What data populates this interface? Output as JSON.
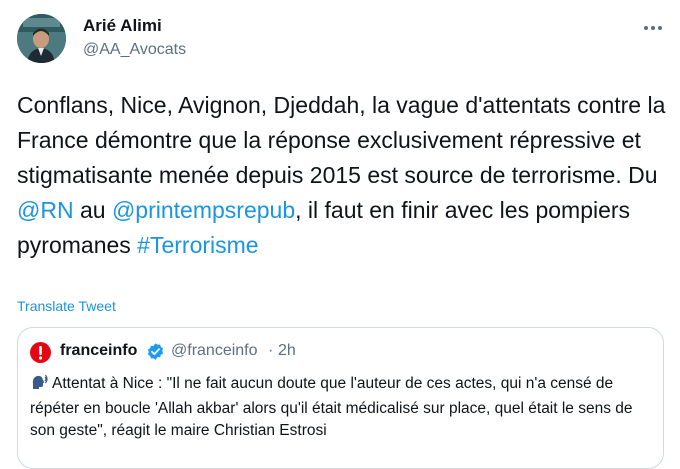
{
  "author": {
    "name": "Arié Alimi",
    "handle": "@AA_Avocats",
    "avatar_icon": "profile-photo"
  },
  "tweet": {
    "segments": [
      {
        "text": "Conflans, Nice, Avignon, Djeddah, la vague d'attentats contre la France démontre que la réponse exclusivement répressive et stigmatisante menée depuis 2015 est source de terrorisme. Du ",
        "link": false
      },
      {
        "text": "@RN",
        "link": true
      },
      {
        "text": " au ",
        "link": false
      },
      {
        "text": "@printempsrepub",
        "link": true
      },
      {
        "text": ", il faut en finir avec les pompiers pyromanes ",
        "link": false
      },
      {
        "text": "#Terrorisme",
        "link": true
      }
    ],
    "translate_label": "Translate Tweet"
  },
  "quote": {
    "name": "franceinfo",
    "verified_icon": "verified-badge-icon",
    "handle": "@franceinfo",
    "separator": "·",
    "time": "2h",
    "emoji_icon": "speaking-head-icon",
    "text": "Attentat à Nice : \"Il ne fait aucun doute que l'auteur de ces actes, qui n'a censé de répéter en boucle 'Allah akbar' alors qu'il était médicalisé sur place, quel était le sens de son geste\", réagit le maire Christian Estrosi"
  },
  "colors": {
    "text": "#0f1419",
    "secondary": "#5b7083",
    "link": "#1b95e0",
    "border": "#cfd9de",
    "franceinfo_red": "#e30613"
  }
}
